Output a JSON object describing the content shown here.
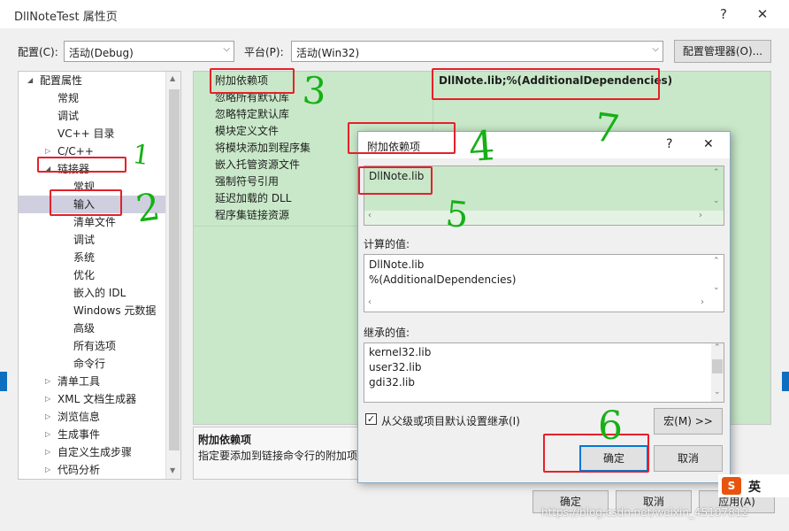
{
  "window": {
    "title": "DllNoteTest 属性页",
    "help": "?",
    "close": "✕"
  },
  "config_bar": {
    "config_label": "配置(C):",
    "config_value": "活动(Debug)",
    "platform_label": "平台(P):",
    "platform_value": "活动(Win32)",
    "manager_button": "配置管理器(O)..."
  },
  "tree": {
    "items": [
      {
        "label": "配置属性",
        "expander": "◢"
      },
      {
        "label": "常规"
      },
      {
        "label": "调试"
      },
      {
        "label": "VC++ 目录"
      },
      {
        "label": "C/C++",
        "expander": "▷"
      },
      {
        "label": "链接器",
        "expander": "◢"
      },
      {
        "label": "常规"
      },
      {
        "label": "输入"
      },
      {
        "label": "清单文件"
      },
      {
        "label": "调试"
      },
      {
        "label": "系统"
      },
      {
        "label": "优化"
      },
      {
        "label": "嵌入的 IDL"
      },
      {
        "label": "Windows 元数据"
      },
      {
        "label": "高级"
      },
      {
        "label": "所有选项"
      },
      {
        "label": "命令行"
      },
      {
        "label": "清单工具",
        "expander": "▷"
      },
      {
        "label": "XML 文档生成器",
        "expander": "▷"
      },
      {
        "label": "浏览信息",
        "expander": "▷"
      },
      {
        "label": "生成事件",
        "expander": "▷"
      },
      {
        "label": "自定义生成步骤",
        "expander": "▷"
      },
      {
        "label": "代码分析",
        "expander": "▷"
      }
    ]
  },
  "grid": {
    "rows": [
      {
        "name": "附加依赖项",
        "value": "DllNote.lib;%(AdditionalDependencies)"
      },
      {
        "name": "忽略所有默认库",
        "value": ""
      },
      {
        "name": "忽略特定默认库",
        "value": ""
      },
      {
        "name": "模块定义文件",
        "value": ""
      },
      {
        "name": "将模块添加到程序集",
        "value": ""
      },
      {
        "name": "嵌入托管资源文件",
        "value": ""
      },
      {
        "name": "强制符号引用",
        "value": ""
      },
      {
        "name": "延迟加载的 DLL",
        "value": ""
      },
      {
        "name": "程序集链接资源",
        "value": ""
      }
    ]
  },
  "description": {
    "title": "附加依赖项",
    "text": "指定要添加到链接命令行的附加项,"
  },
  "footer": {
    "ok": "确定",
    "cancel": "取消",
    "apply": "应用(A)",
    "watermark": "https://blog.csdn.net/weixin_45107812"
  },
  "dialog": {
    "title": "附加依赖项",
    "help": "?",
    "close": "✕",
    "edit_lines": [
      "DllNote.lib"
    ],
    "computed_label": "计算的值:",
    "computed_lines": [
      "DllNote.lib",
      "%(AdditionalDependencies)"
    ],
    "inherited_label": "继承的值:",
    "inherited_lines": [
      "kernel32.lib",
      "user32.lib",
      "gdi32.lib"
    ],
    "inherit_checkbox": "从父级或项目默认设置继承(I)",
    "inherit_checked": true,
    "macro_button": "宏(M) >>",
    "ok": "确定",
    "cancel": "取消"
  },
  "ime": {
    "logo": "S",
    "text": "英"
  },
  "annotations": [
    "1",
    "2",
    "3",
    "4",
    "5",
    "6",
    "7"
  ],
  "colors": {
    "grid_green": "#c9e8c9",
    "highlight_red": "#e5202a",
    "ink_green": "#16b016",
    "selection": "#cfcfdf"
  }
}
